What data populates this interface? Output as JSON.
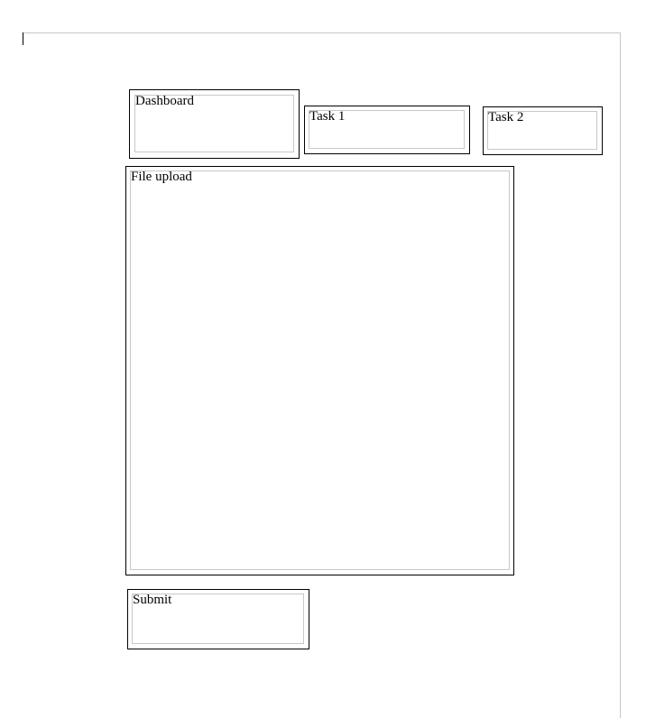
{
  "panels": {
    "dashboard": {
      "label": "Dashboard"
    },
    "task1": {
      "label": "Task 1"
    },
    "task2": {
      "label": "Task 2"
    },
    "file_upload": {
      "label": "File upload"
    },
    "submit": {
      "label": "Submit"
    }
  }
}
